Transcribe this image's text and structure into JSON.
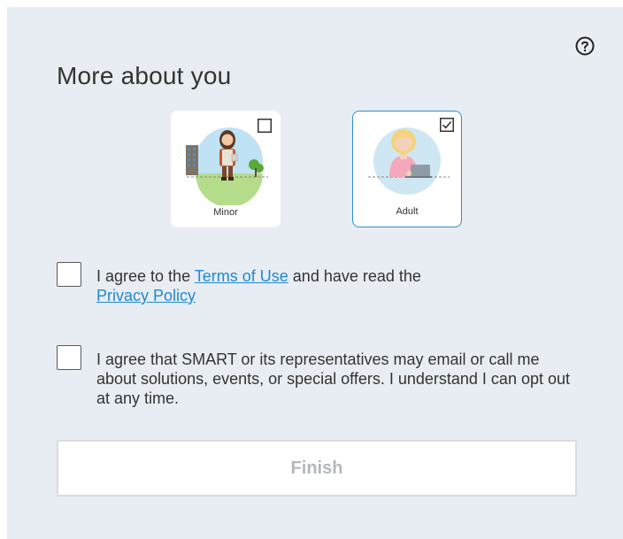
{
  "dialog": {
    "title": "More about you",
    "help_icon": "question-circle-icon"
  },
  "age_options": [
    {
      "label": "Minor",
      "selected": false
    },
    {
      "label": "Adult",
      "selected": true
    }
  ],
  "terms": {
    "prefix": "I agree to the ",
    "terms_link": "Terms of Use",
    "middle": " and have read the ",
    "privacy_link": "Privacy Policy",
    "checked": false
  },
  "marketing": {
    "text": "I agree that SMART or its representatives may email or call me about solutions, events, or special offers. I understand I can opt out at any time.",
    "checked": false
  },
  "finish_button": {
    "label": "Finish",
    "enabled": false
  },
  "colors": {
    "panel_bg": "#e8edf3",
    "accent": "#2b8fd6",
    "link": "#1f88d0",
    "disabled_text": "#b4b8bc"
  }
}
